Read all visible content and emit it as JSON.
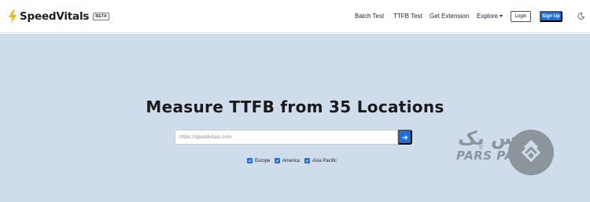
{
  "nav": {
    "brand_name": "SpeedVitals",
    "beta_badge": "BETA",
    "links": [
      {
        "label": "Batch Test"
      },
      {
        "label": "TTFB Test"
      },
      {
        "label": "Get Extension"
      },
      {
        "label": "Explore"
      }
    ],
    "login_label": "Login",
    "signup_label": "Sign Up",
    "icons": {
      "brand": "lightning-bolt-icon",
      "theme": "moon-icon",
      "explore": "caret-down-icon"
    }
  },
  "hero": {
    "title": "Measure TTFB from 35 Locations",
    "search": {
      "placeholder": "https://speedvitals.com",
      "value": "",
      "submit_icon": "arrow-right-icon"
    },
    "regions": [
      {
        "label": "Europe",
        "checked": true
      },
      {
        "label": "America",
        "checked": true
      },
      {
        "label": "Asia Pacific",
        "checked": true
      }
    ]
  },
  "watermark": {
    "text_fa": "پارس پک",
    "text_en": "PARS PACK",
    "icon": "parspack-logo-icon"
  },
  "colors": {
    "accent": "#1d6fe0",
    "hero_background": "#cfdceb",
    "bolt": "#f5b700",
    "watermark": "#8c949c"
  }
}
